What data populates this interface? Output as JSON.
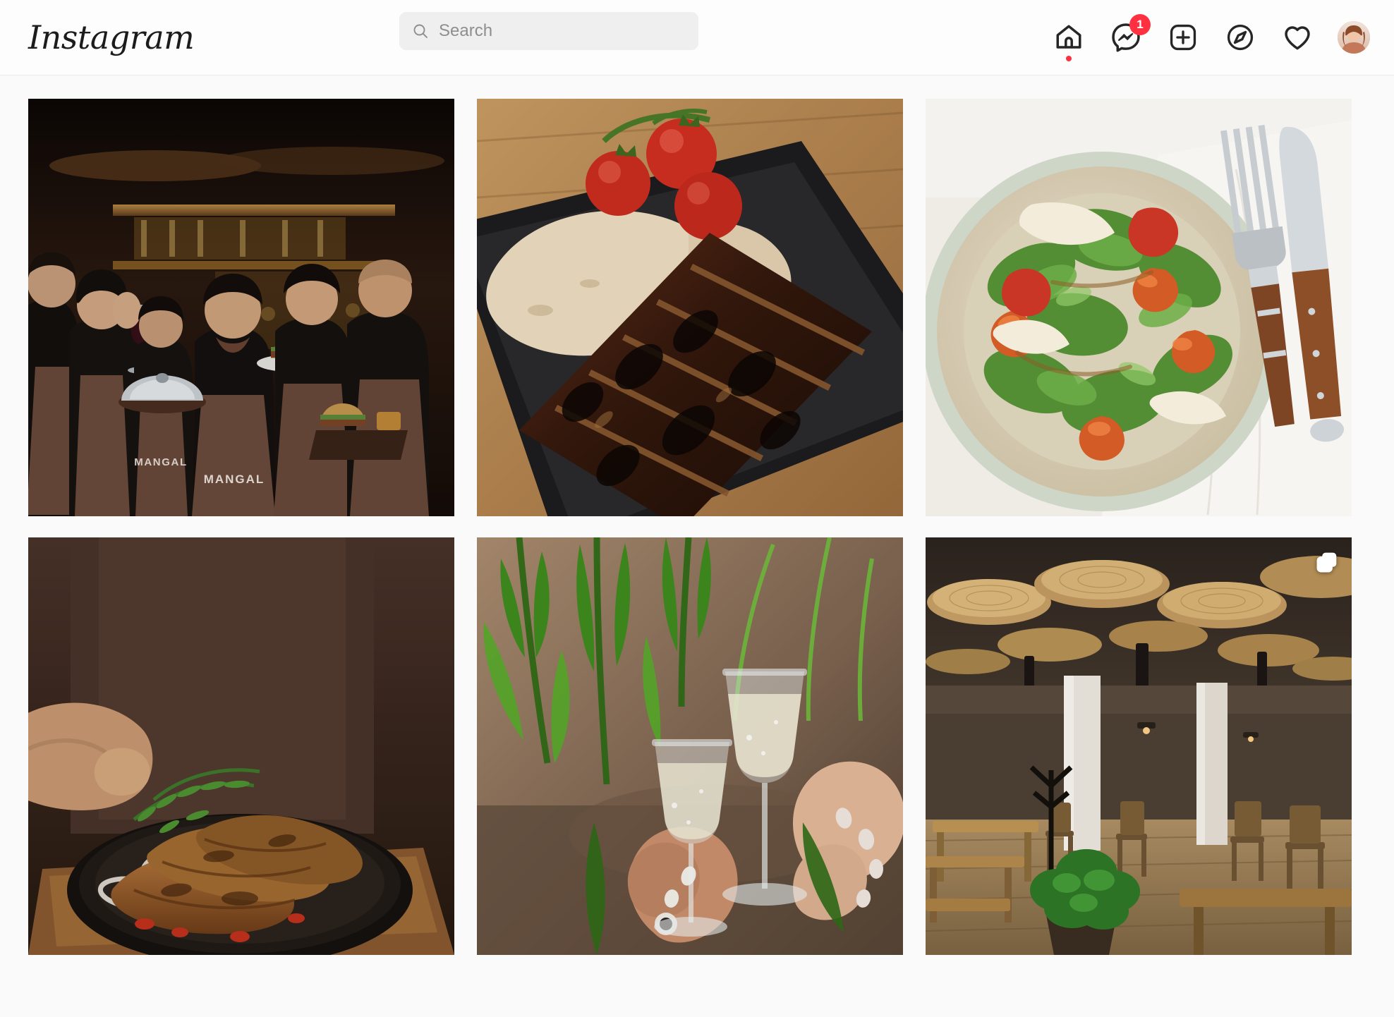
{
  "header": {
    "logo_text": "Instagram",
    "search": {
      "placeholder": "Search",
      "value": "",
      "icon": "search-icon"
    },
    "nav": [
      {
        "name": "home-icon",
        "label": "Home",
        "has_activity_dot": true,
        "badge": null
      },
      {
        "name": "messenger-icon",
        "label": "Messenger",
        "has_activity_dot": false,
        "badge": "1"
      },
      {
        "name": "new-post-icon",
        "label": "New post",
        "has_activity_dot": false,
        "badge": null
      },
      {
        "name": "explore-icon",
        "label": "Explore",
        "has_activity_dot": false,
        "badge": null
      },
      {
        "name": "heart-icon",
        "label": "Notifications",
        "has_activity_dot": false,
        "badge": null
      }
    ],
    "avatar": {
      "name": "profile-avatar",
      "label": "Profile"
    }
  },
  "colors": {
    "accent_red": "#ff3040",
    "page_background": "#fafafa",
    "header_background": "#fdfdfd",
    "search_background": "#efefef",
    "text_primary": "#1c1c1c",
    "text_muted": "#8e8e8e"
  },
  "grid": {
    "columns": 3,
    "posts": [
      {
        "id": "post-1",
        "alt": "Restaurant staff team in brown MANGAL aprons holding burger plates and a silver cloche in a dark bar",
        "is_carousel": false,
        "brand_text_on_aprons": "MANGAL"
      },
      {
        "id": "post-2",
        "alt": "Charred sliced grilled meat on a cast-iron skillet with flatbread and vine tomatoes",
        "is_carousel": false
      },
      {
        "id": "post-3",
        "alt": "Shrimp and arugula salad with parmesan shavings on a ceramic plate beside a fork and knife",
        "is_carousel": false
      },
      {
        "id": "post-4",
        "alt": "Grilled sausages with rosemary and onions on a black pan held by a chef in a brown apron",
        "is_carousel": false
      },
      {
        "id": "post-5",
        "alt": "Two hands toasting champagne flutes among green palm leaves",
        "is_carousel": false
      },
      {
        "id": "post-6",
        "alt": "Modern restaurant interior with woven disc ceiling lamps, white columns and wooden tables",
        "is_carousel": true
      }
    ]
  }
}
